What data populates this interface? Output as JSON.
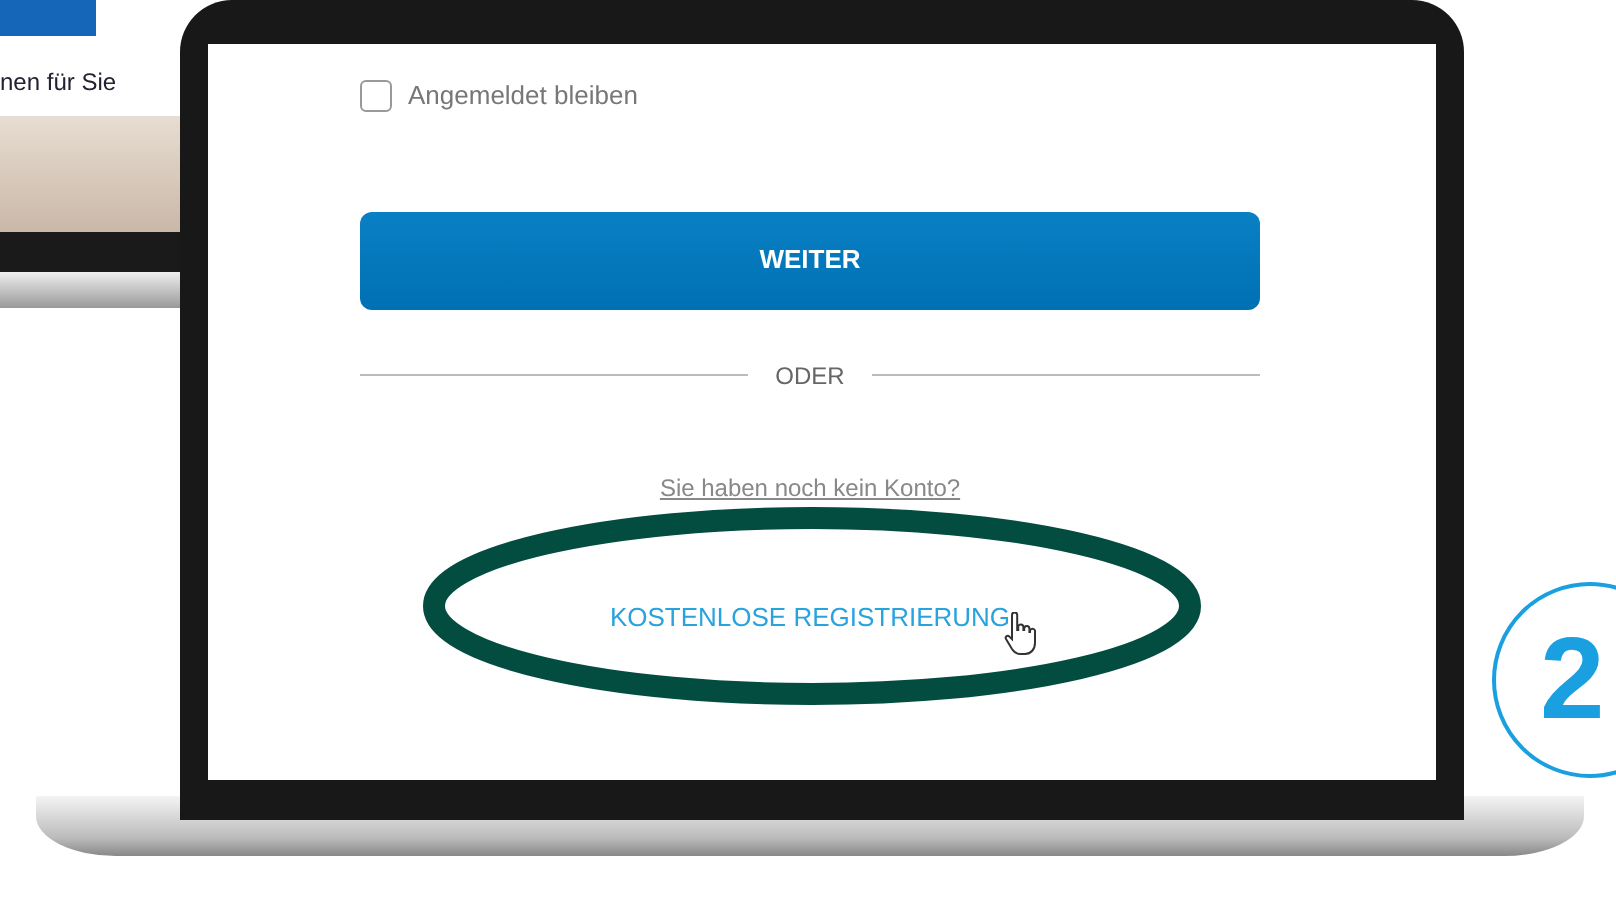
{
  "background_laptop": {
    "caption": "nen für Sie"
  },
  "login": {
    "remember": {
      "label": "Angemeldet bleiben",
      "checked": false
    },
    "submit": "WEITER",
    "divider": "ODER",
    "prompt": "Sie haben noch kein Konto?",
    "register_link": "KOSTENLOSE REGISTRIERUNG"
  },
  "step_badge": "2"
}
